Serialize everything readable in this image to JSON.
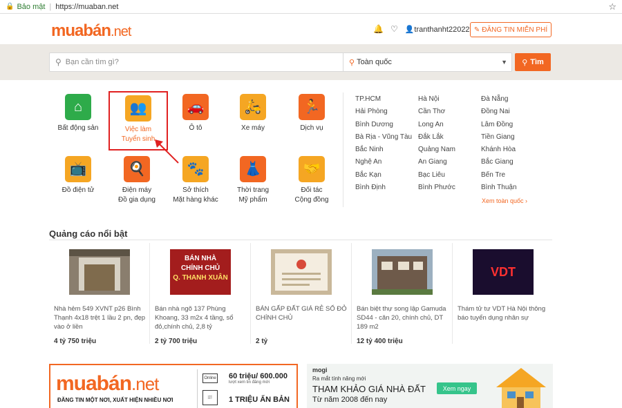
{
  "browser": {
    "secure_label": "Bảo mật",
    "url": "https://muaban.net"
  },
  "header": {
    "logo_main": "muabán",
    "logo_suffix": ".net",
    "username": "tranthanht22022...",
    "post_button": "ĐĂNG TIN MIỄN PHÍ"
  },
  "search": {
    "placeholder": "Bạn cần tìm gì?",
    "location": "Toàn quốc",
    "button": "Tìm"
  },
  "categories": [
    {
      "line1": "Bất động sản",
      "line2": "",
      "icon": "house-icon",
      "color": "#2eab4a"
    },
    {
      "line1": "Việc làm",
      "line2": "Tuyển sinh",
      "icon": "people-icon",
      "color": "#f5a623"
    },
    {
      "line1": "Ô tô",
      "line2": "",
      "icon": "car-icon",
      "color": "#f26722"
    },
    {
      "line1": "Xe máy",
      "line2": "",
      "icon": "scooter-icon",
      "color": "#f5a623"
    },
    {
      "line1": "Dịch vụ",
      "line2": "",
      "icon": "runner-icon",
      "color": "#f26722"
    },
    {
      "line1": "Đồ điện tử",
      "line2": "",
      "icon": "tv-icon",
      "color": "#f5a623"
    },
    {
      "line1": "Điện máy",
      "line2": "Đồ gia dụng",
      "icon": "appliance-icon",
      "color": "#f26722"
    },
    {
      "line1": "Sở thích",
      "line2": "Mặt hàng khác",
      "icon": "paw-icon",
      "color": "#f5a623"
    },
    {
      "line1": "Thời trang",
      "line2": "Mỹ phẩm",
      "icon": "dress-icon",
      "color": "#f26722"
    },
    {
      "line1": "Đối tác",
      "line2": "Cộng đồng",
      "icon": "handshake-icon",
      "color": "#f5a623"
    }
  ],
  "provinces": {
    "col1": [
      "TP.HCM",
      "Hải Phòng",
      "Bình Dương",
      "Bà Rịa - Vũng Tàu",
      "Bắc Ninh",
      "Nghệ An",
      "Bắc Kạn",
      "Bình Định"
    ],
    "col2": [
      "Hà Nội",
      "Cần Thơ",
      "Long An",
      "Đắk Lắk",
      "Quảng Nam",
      "An Giang",
      "Bạc Liêu",
      "Bình Phước"
    ],
    "col3": [
      "Đà Nẵng",
      "Đồng Nai",
      "Lâm Đồng",
      "Tiền Giang",
      "Khánh Hòa",
      "Bắc Giang",
      "Bến Tre",
      "Bình Thuận"
    ],
    "more": "Xem toàn quốc ›"
  },
  "featured": {
    "title": "Quảng cáo nổi bật",
    "ads": [
      {
        "text": "Nhà hẻm 549 XVNT p26 Bình Thạnh 4x18 trệt 1 lầu 2 pn, đẹp vào ở liền",
        "price": "4 tỷ 750 triệu"
      },
      {
        "text": "Bán nhà ngõ 137 Phùng Khoang, 33 m2x 4 tầng, sổ đỏ,chính chủ, 2,8 tỷ",
        "price": "2 tỷ 700 triệu"
      },
      {
        "text": "BÁN GẤP ĐẤT GIÁ RẺ SỔ ĐỎ CHÍNH CHỦ",
        "price": "2 tỷ"
      },
      {
        "text": "Bán biệt thự song lập Gamuda SD44 - căn 20, chính chủ, DT 189 m2",
        "price": "12 tỷ 400 triệu"
      },
      {
        "text": "Thám tử tư VDT Hà Nội thông báo tuyển dụng nhân sự",
        "price": ""
      }
    ],
    "ad2_img": [
      "BÁN NHÀ",
      "CHÍNH CHỦ",
      "Q. THANH XUÂN"
    ],
    "ad5_img": "VDT"
  },
  "banner1": {
    "logo_main": "muabán",
    "logo_suffix": ".net",
    "tagline": "ĐĂNG TIN MỘT NƠI, XUẤT HIỆN NHIỀU NƠI",
    "online_label": "Online",
    "stat1": "60 triệu/ 600.000",
    "stat1_sub": "lượt xem          tin đăng mới",
    "stat2": "1 TRIỆU ẤN BẢN"
  },
  "banner2": {
    "brand": "mogi",
    "line1": "Ra mắt tính năng mới",
    "line2": "THAM KHẢO GIÁ NHÀ ĐẤT",
    "line3": "Từ năm 2008 đến nay",
    "button": "Xem ngay"
  }
}
